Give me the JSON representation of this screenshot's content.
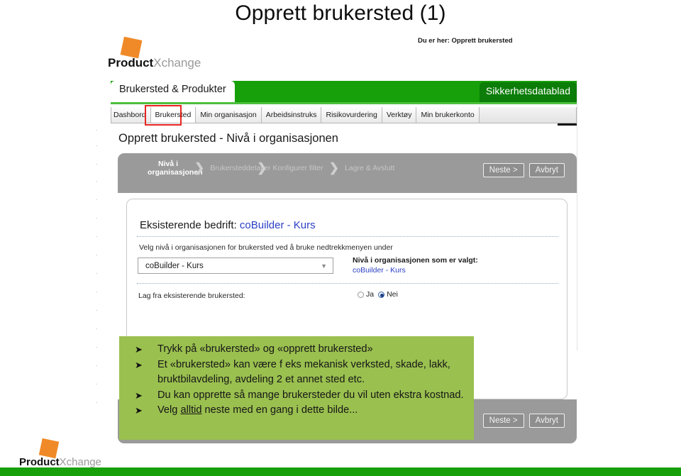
{
  "slide": {
    "title": "Opprett brukersted (1)"
  },
  "brand": {
    "bold": "Product",
    "light": "Xchange"
  },
  "breadcrumb": {
    "text": "Du er her: Opprett brukersted"
  },
  "app": {
    "site_tab": "Brukersted & Produkter",
    "sds_tab": "Sikkerhetsdatablad",
    "nav_tabs": [
      {
        "label": "Dashbord",
        "active": false
      },
      {
        "label": "Brukersted",
        "active": true
      },
      {
        "label": "Min organisasjon",
        "active": false
      },
      {
        "label": "Arbeidsinstruks",
        "active": false
      },
      {
        "label": "Risikovurdering",
        "active": false
      },
      {
        "label": "Verktøy",
        "active": false
      },
      {
        "label": "Min brukerkonto",
        "active": false
      }
    ],
    "page_heading": "Opprett brukersted - Nivå i organisasjonen",
    "wizard": {
      "steps": [
        {
          "label": "Nivå i organisasjonen",
          "current": true
        },
        {
          "label": "Brukersteddetaljer",
          "current": false
        },
        {
          "label": "Konfigurer filter",
          "current": false
        },
        {
          "label": "Lagre & Avslutt",
          "current": false
        }
      ],
      "chevron": "❯",
      "next_label": "Neste >",
      "cancel_label": "Avbryt"
    },
    "form": {
      "company_label": "Eksisterende bedrift:",
      "company_value": "coBuilder - Kurs",
      "help_text": "Velg nivå i organisasjonen for brukersted ved å bruke nedtrekkmenyen under",
      "select_value": "coBuilder - Kurs",
      "select_caret": "▼",
      "selected_level_label": "Nivå i organisasjonen som er valgt:",
      "selected_level_value": "coBuilder - Kurs",
      "copy_label": "Lag fra eksisterende brukersted:",
      "radio_yes": "Ja",
      "radio_no": "Nei",
      "radio_selected": "Nei"
    },
    "footer_buttons": {
      "next_label": "Neste >",
      "cancel_label": "Avbryt"
    }
  },
  "callout": {
    "bullet_marker": "➤",
    "items": [
      {
        "pre": "Trykk på «brukersted» og «opprett brukersted»"
      },
      {
        "pre": "Et «brukersted» kan være f eks mekanisk verksted, skade, lakk, bruktbilavdeling, avdeling 2 et annet sted etc."
      },
      {
        "pre": "Du kan opprette så mange brukersteder du vil uten ekstra kostnad."
      }
    ],
    "last_item": {
      "pre": "Velg ",
      "underline": "alltid",
      "post": " neste med en gang i dette bilde..."
    }
  },
  "colors": {
    "brand_green": "#17a00a",
    "dark_green": "#0b7d08",
    "callout_green": "#9ac04f",
    "orange": "#f08a28",
    "link_blue": "#2b3fc4",
    "highlight_red": "#e8241f"
  }
}
